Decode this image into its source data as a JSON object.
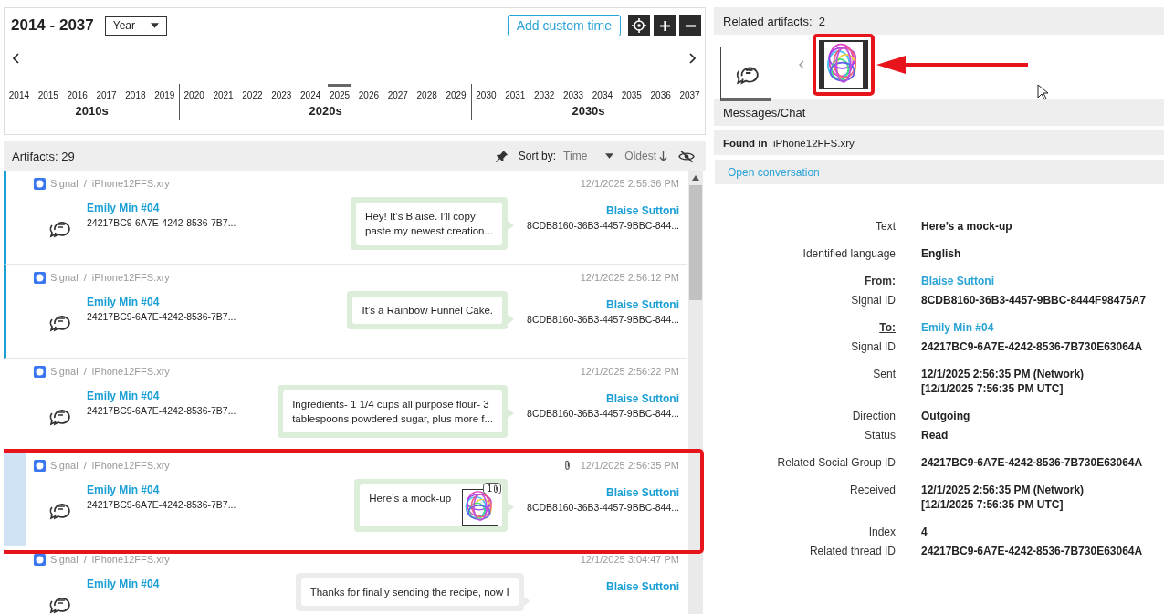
{
  "timeline": {
    "title": "2014 - 2037",
    "scale": "Year",
    "add_button": "Add custom time",
    "decades": [
      {
        "label": "2010s",
        "years": [
          {
            "label": "2014",
            "selected": false
          },
          {
            "label": "2015",
            "selected": false
          },
          {
            "label": "2016",
            "selected": false
          },
          {
            "label": "2017",
            "selected": false
          },
          {
            "label": "2018",
            "selected": false
          },
          {
            "label": "2019",
            "selected": false
          }
        ]
      },
      {
        "label": "2020s",
        "years": [
          {
            "label": "2020",
            "selected": false
          },
          {
            "label": "2021",
            "selected": false
          },
          {
            "label": "2022",
            "selected": false
          },
          {
            "label": "2023",
            "selected": false
          },
          {
            "label": "2024",
            "selected": false
          },
          {
            "label": "2025",
            "selected": true
          },
          {
            "label": "2026",
            "selected": false
          },
          {
            "label": "2027",
            "selected": false
          },
          {
            "label": "2028",
            "selected": false
          },
          {
            "label": "2029",
            "selected": false
          }
        ]
      },
      {
        "label": "2030s",
        "years": [
          {
            "label": "2030",
            "selected": false
          },
          {
            "label": "2031",
            "selected": false
          },
          {
            "label": "2032",
            "selected": false
          },
          {
            "label": "2033",
            "selected": false
          },
          {
            "label": "2034",
            "selected": false
          },
          {
            "label": "2035",
            "selected": false
          },
          {
            "label": "2036",
            "selected": false
          },
          {
            "label": "2037",
            "selected": false
          }
        ]
      }
    ]
  },
  "artifacts": {
    "label": "Artifacts:",
    "count": "29",
    "sort_label": "Sort by:",
    "sort_field": "Time",
    "sort_order": "Oldest",
    "rows": [
      {
        "source": "Signal  /  iPhone12FFS.xry",
        "time": "12/1/2025 2:55:36 PM",
        "from": "Emily Min #04",
        "from_id": "24217BC9-6A7E-4242-8536-7B7...",
        "message": "Hey! It’s Blaise. I’ll copy\npaste my newest creation...",
        "to": "Blaise Suttoni",
        "to_id": "8CDB8160-36B3-4457-9BBC-844...",
        "color": "#dcedd9",
        "flagged": true,
        "selected": false,
        "highlighted": false
      },
      {
        "source": "Signal  /  iPhone12FFS.xry",
        "time": "12/1/2025 2:56:12 PM",
        "from": "Emily Min #04",
        "from_id": "24217BC9-6A7E-4242-8536-7B7...",
        "message": "It’s a Rainbow Funnel Cake.",
        "to": "Blaise Suttoni",
        "to_id": "8CDB8160-36B3-4457-9BBC-844...",
        "color": "#dcedd9",
        "flagged": true,
        "selected": false,
        "highlighted": false
      },
      {
        "source": "Signal  /  iPhone12FFS.xry",
        "time": "12/1/2025 2:56:22 PM",
        "from": "Emily Min #04",
        "from_id": "24217BC9-6A7E-4242-8536-7B7...",
        "message": "Ingredients- 1 1/4 cups all purpose flour- 3\ntablespoons powdered sugar, plus more f...",
        "to": "Blaise Suttoni",
        "to_id": "8CDB8160-36B3-4457-9BBC-844...",
        "color": "#dcedd9",
        "flagged": false,
        "selected": false,
        "highlighted": false
      },
      {
        "source": "Signal  /  iPhone12FFS.xry",
        "time": "12/1/2025 2:56:35 PM",
        "from": "Emily Min #04",
        "from_id": "24217BC9-6A7E-4242-8536-7B7...",
        "message": "Here’s a mock-up",
        "attachments": "1",
        "to": "Blaise Suttoni",
        "to_id": "8CDB8160-36B3-4457-9BBC-844...",
        "color": "#dcedd9",
        "flagged": false,
        "selected": true,
        "highlighted": true
      },
      {
        "source": "Signal  /  iPhone12FFS.xry",
        "time": "12/1/2025 3:04:47 PM",
        "from": "Emily Min #04",
        "message": "Thanks for finally sending the recipe, now I",
        "to": "Blaise Suttoni",
        "color": "#ececec",
        "flagged": false,
        "selected": false
      }
    ]
  },
  "related": {
    "label": "Related artifacts:",
    "count": "2",
    "items": [
      {
        "kind": "chat",
        "selected": true,
        "highlighted": false
      },
      {
        "kind": "picture",
        "selected": false,
        "highlighted": true
      }
    ]
  },
  "category": "Messages/Chat",
  "found_in": {
    "label": "Found in",
    "value": "iPhone12FFS.xry"
  },
  "open_link": "Open conversation",
  "details": [
    {
      "fields": [
        {
          "label": "Text",
          "value": "Here’s a mock-up",
          "kind": "text",
          "underlined": false
        }
      ]
    },
    {
      "fields": [
        {
          "label": "Identified language",
          "value": "English",
          "kind": "text",
          "underlined": false
        }
      ]
    },
    {
      "fields": [
        {
          "label": "From:",
          "value": "Blaise Suttoni",
          "kind": "link",
          "underlined": true
        },
        {
          "label": "Signal ID",
          "value": "8CDB8160-36B3-4457-9BBC-8444F98475A7",
          "kind": "text",
          "underlined": false
        }
      ]
    },
    {
      "fields": [
        {
          "label": "To:",
          "value": "Emily Min #04",
          "kind": "link",
          "underlined": true
        },
        {
          "label": "Signal ID",
          "value": "24217BC9-6A7E-4242-8536-7B730E63064A",
          "kind": "text",
          "underlined": false
        }
      ]
    },
    {
      "fields": [
        {
          "label": "Sent",
          "value": "12/1/2025 2:56:35 PM (Network)\n[12/1/2025 7:56:35 PM UTC]",
          "kind": "text",
          "underlined": false
        }
      ]
    },
    {
      "fields": [
        {
          "label": "Direction",
          "value": "Outgoing",
          "kind": "text",
          "underlined": false
        },
        {
          "label": "Status",
          "value": "Read",
          "kind": "text",
          "underlined": false
        }
      ]
    },
    {
      "fields": [
        {
          "label": "Related Social Group ID",
          "value": "24217BC9-6A7E-4242-8536-7B730E63064A",
          "kind": "text",
          "underlined": false
        }
      ]
    },
    {
      "fields": [
        {
          "label": "Received",
          "value": "12/1/2025 2:56:35 PM (Network)\n[12/1/2025 7:56:35 PM UTC]",
          "kind": "text",
          "underlined": false
        }
      ]
    },
    {
      "fields": [
        {
          "label": "Index",
          "value": "4",
          "kind": "text",
          "underlined": false
        },
        {
          "label": "Related thread ID",
          "value": "24217BC9-6A7E-4242-8536-7B730E63064A",
          "kind": "text",
          "underlined": false
        }
      ]
    }
  ]
}
